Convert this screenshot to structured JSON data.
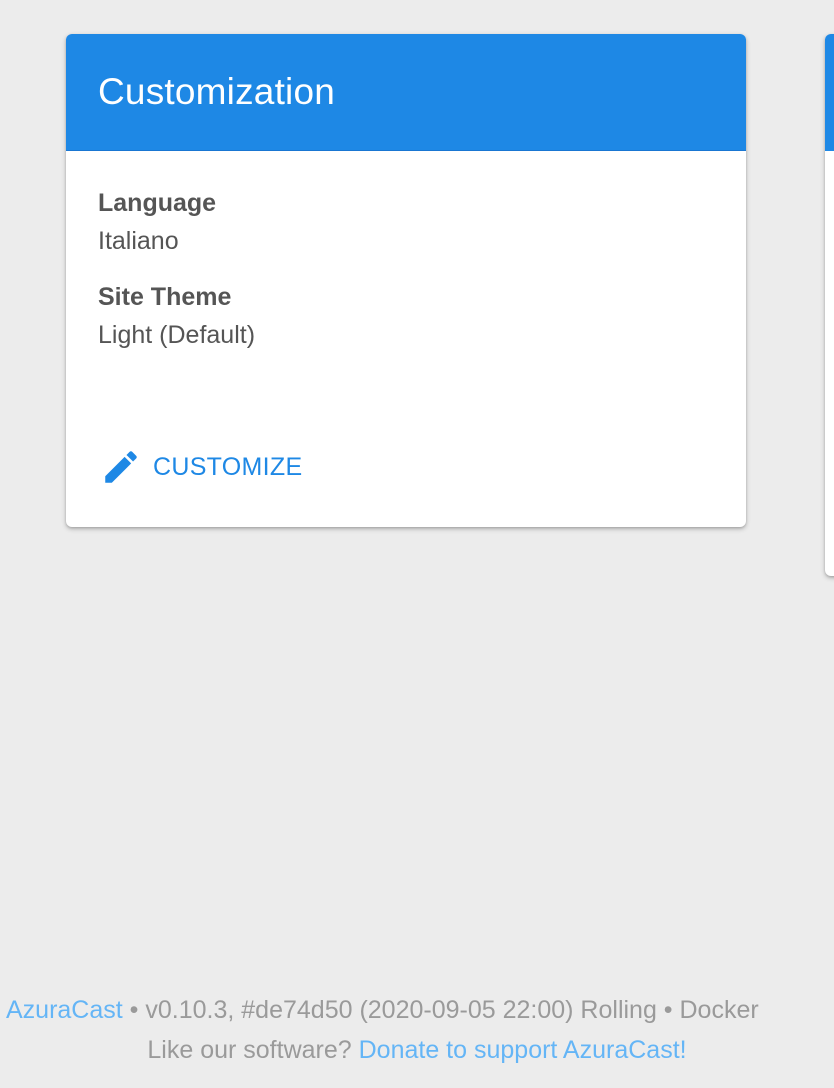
{
  "customization_card": {
    "title": "Customization",
    "fields": [
      {
        "label": "Language",
        "value": "Italiano"
      },
      {
        "label": "Site Theme",
        "value": "Light (Default)"
      }
    ],
    "action": {
      "icon": "pencil-icon",
      "label": "CUSTOMIZE"
    }
  },
  "colors": {
    "header": "#1e88e5",
    "accent": "#1e88e5",
    "link": "#64b5f6",
    "background": "#ececec"
  },
  "footer": {
    "app_link": "AzuraCast",
    "version_info": "• v0.10.3, #de74d50 (2020-09-05 22:00) Rolling • Docker",
    "donate_prompt": "Like our software?",
    "donate_link": "Donate to support AzuraCast!"
  }
}
